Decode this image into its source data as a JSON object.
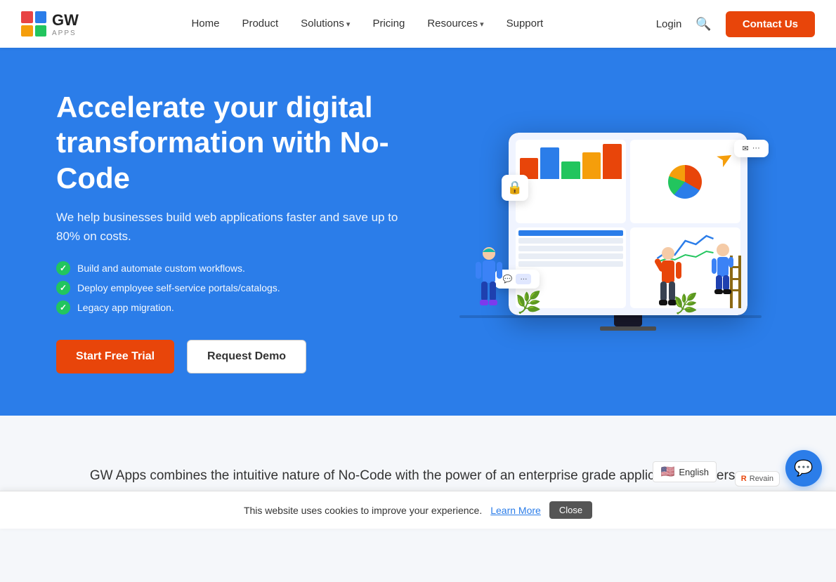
{
  "logo": {
    "text": "GW",
    "subtext": "APPS",
    "colors": [
      "#e84444",
      "#2b7de9",
      "#f59e0b",
      "#22c55e"
    ]
  },
  "nav": {
    "home": "Home",
    "product": "Product",
    "solutions": "Solutions",
    "pricing": "Pricing",
    "resources": "Resources",
    "support": "Support",
    "login": "Login",
    "contact": "Contact Us"
  },
  "hero": {
    "heading": "Accelerate your digital transformation with No-Code",
    "subtext": "We help businesses build web applications faster and save up to 80% on costs.",
    "features": [
      "Build and automate custom workflows.",
      "Deploy employee self-service portals/catalogs.",
      "Legacy app migration."
    ],
    "btn_trial": "Start Free Trial",
    "btn_demo": "Request Demo"
  },
  "section2": {
    "text": "GW Apps combines the intuitive nature of No-Code with the power of an enterprise grade application. It offers a visual, quick, and secure way for IT and line of business employees to build the customized apps they need to better manage their business processes and data."
  },
  "cookie": {
    "message": "This website uses cookies to improve your experience.",
    "learn_more": "Learn More",
    "close": "Close"
  },
  "lang": {
    "flag": "🇺🇸",
    "label": "English"
  },
  "chat": {
    "icon": "💬"
  }
}
